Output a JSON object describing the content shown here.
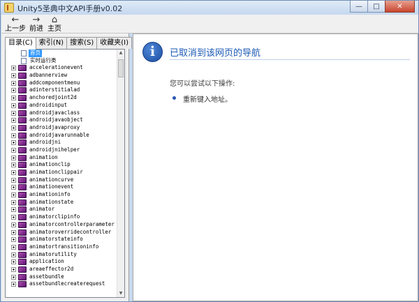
{
  "window": {
    "title": "Unity5圣典中文API手册v0.02",
    "controls": {
      "minimize": "—",
      "maximize": "□",
      "close": "✕"
    }
  },
  "toolbar": {
    "back": {
      "label": "上一步",
      "icon": "←"
    },
    "forward": {
      "label": "前进",
      "icon": "→"
    },
    "home": {
      "label": "主页",
      "icon": "⌂"
    }
  },
  "tabs": [
    "目录(C)",
    "索引(N)",
    "搜索(S)",
    "收藏夹(I)"
  ],
  "tree": {
    "top_items": [
      "首页",
      "实时运行类"
    ],
    "items": [
      "accelerationevent",
      "adbannerview",
      "addcomponentmenu",
      "adinterstitialad",
      "anchoredjoint2d",
      "androidinput",
      "androidjavaclass",
      "androidjavaobject",
      "androidjavaproxy",
      "androidjavarunnable",
      "androidjni",
      "androidjnihelper",
      "animation",
      "animationclip",
      "animationclippair",
      "animationcurve",
      "animationevent",
      "animationinfo",
      "animationstate",
      "animator",
      "animatorclipinfo",
      "animatorcontrollerparameter",
      "animatoroverridecontroller",
      "animatorstateinfo",
      "animatortransitioninfo",
      "animatorutility",
      "application",
      "areaeffector2d",
      "assetbundle",
      "assetbundlecreaterequest"
    ]
  },
  "content": {
    "heading": "已取消到该网页的导航",
    "subtext": "您可以尝试以下操作:",
    "actions": [
      "重新键入地址。"
    ]
  }
}
